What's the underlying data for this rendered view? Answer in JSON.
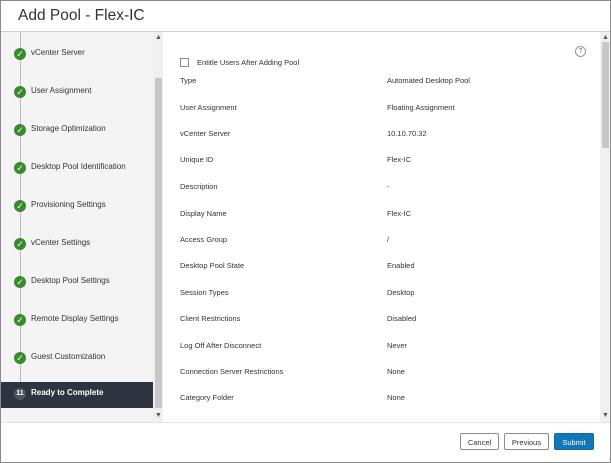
{
  "dialog": {
    "title": "Add Pool - Flex-IC"
  },
  "sidebar": {
    "steps": [
      {
        "label": "vCenter Server",
        "state": "done"
      },
      {
        "label": "User Assignment",
        "state": "done"
      },
      {
        "label": "Storage Optimization",
        "state": "done"
      },
      {
        "label": "Desktop Pool Identification",
        "state": "done"
      },
      {
        "label": "Provisioning Settings",
        "state": "done"
      },
      {
        "label": "vCenter Settings",
        "state": "done"
      },
      {
        "label": "Desktop Pool Settings",
        "state": "done"
      },
      {
        "label": "Remote Display Settings",
        "state": "done"
      },
      {
        "label": "Guest Customization",
        "state": "done"
      },
      {
        "label": "Ready to Complete",
        "state": "active",
        "number": "11"
      }
    ],
    "check_glyph": "✓"
  },
  "main": {
    "help_glyph": "?",
    "entitle_label": "Entitle Users After Adding Pool",
    "entitle_checked": false,
    "summary": [
      {
        "key": "Type",
        "value": "Automated Desktop Pool"
      },
      {
        "key": "User Assignment",
        "value": "Floating Assignment"
      },
      {
        "key": "vCenter Server",
        "value": "10.10.70.32"
      },
      {
        "key": "Unique ID",
        "value": "Flex-IC"
      },
      {
        "key": "Description",
        "value": "-"
      },
      {
        "key": "Display Name",
        "value": "Flex-IC"
      },
      {
        "key": "Access Group",
        "value": "/"
      },
      {
        "key": "Desktop Pool State",
        "value": "Enabled"
      },
      {
        "key": "Session Types",
        "value": "Desktop"
      },
      {
        "key": "Client Restrictions",
        "value": "Disabled"
      },
      {
        "key": "Log Off After Disconnect",
        "value": "Never"
      },
      {
        "key": "Connection Server Restrictions",
        "value": "None"
      },
      {
        "key": "Category Folder",
        "value": "None"
      }
    ]
  },
  "footer": {
    "cancel_label": "Cancel",
    "previous_label": "Previous",
    "submit_label": "Submit"
  },
  "colors": {
    "done": "#3c8a2e",
    "active_bg": "#2f3540",
    "submit": "#1177b9"
  }
}
